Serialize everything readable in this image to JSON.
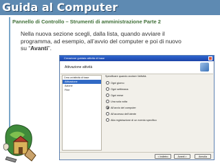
{
  "slide": {
    "title": "Guida al Computer",
    "subtitle": "Pannello di Controllo – Strumenti di amministrazione Parte 2",
    "body_line1": "Nella nuova sezione scegli, dalla lista, quando avviare il",
    "body_line2": "programma, ad esempio, all’avvio del computer e poi di nuovo",
    "body_line3_prefix": "su “",
    "body_line3_bold": "Avanti",
    "body_line3_suffix": "”."
  },
  "wizard": {
    "window_title": "Creazione guidata attività di base",
    "header_title": "Attivazione attività",
    "left_panel": {
      "header": "Crea un'attività di base",
      "items": [
        "Attivazione",
        "Azione",
        "Fine"
      ],
      "selected_index": 0
    },
    "question": "Specificare quando avviare l'attività.",
    "options": [
      "Ogni giorno",
      "Ogni settimana",
      "Ogni mese",
      "Una sola volta",
      "All'avvio del computer",
      "All'accesso dell'utente",
      "Alla registrazione di un evento specifico"
    ],
    "selected_option_index": 4,
    "buttons": {
      "back": "< Indietro",
      "next": "Avanti >",
      "cancel": "Annulla"
    }
  },
  "colors": {
    "title_bar": "#5e8ab2",
    "subtitle": "#3f6f37",
    "accent_line": "#7aa6c9"
  }
}
